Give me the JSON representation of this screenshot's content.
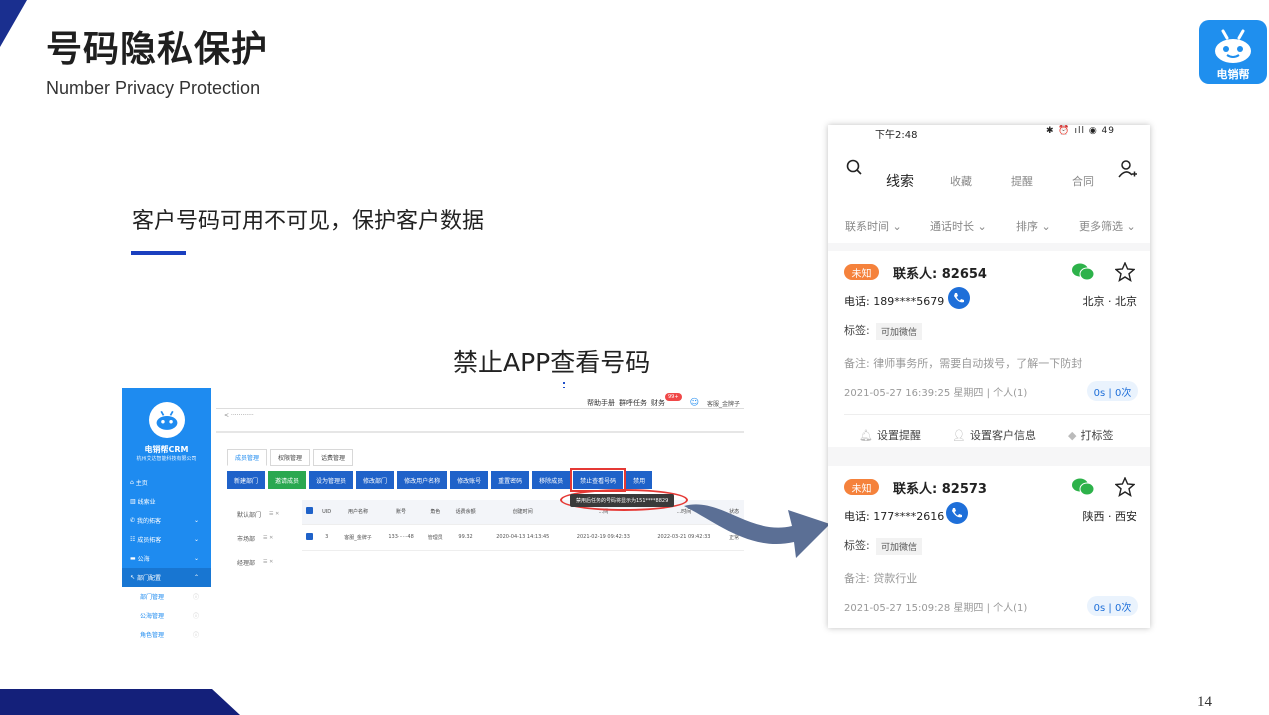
{
  "slide": {
    "title": "号码隐私保护",
    "subtitle": "Number Privacy Protection",
    "tagline": "客户号码可用不可见，保护客户数据",
    "disable_caption": "禁止APP查看号码",
    "page_number": "14",
    "accent_color": "#1a2f8f"
  },
  "logo": {
    "label": "电销帮",
    "icon": "robot-icon",
    "color": "#1f8fee"
  },
  "crm": {
    "brand": "电销帮CRM",
    "company": "杭州艾达智能科技有限公司",
    "nav": [
      {
        "label": "主页",
        "icon": "home-icon",
        "chevron": ""
      },
      {
        "label": "线索业",
        "icon": "chart-icon",
        "chevron": ""
      },
      {
        "label": "我的拓客",
        "icon": "phone-icon",
        "chevron": "⌄"
      },
      {
        "label": "成员拓客",
        "icon": "team-icon",
        "chevron": "⌄"
      },
      {
        "label": "公海",
        "icon": "folder-icon",
        "chevron": "⌄"
      },
      {
        "label": "部门配置",
        "icon": "tool-icon",
        "chevron": "⌃"
      }
    ],
    "subnav": [
      "部门管理",
      "公海管理",
      "角色管理"
    ],
    "back_label": "< ············",
    "top_links": [
      "帮助手册",
      "群呼任务",
      "财务"
    ],
    "badge": "99+",
    "user": "客服_金牌子",
    "tabs": [
      "成员管理",
      "权限管理",
      "话费管理"
    ],
    "buttons": [
      {
        "label": "新建部门",
        "style": "primary"
      },
      {
        "label": "邀请成员",
        "style": "green"
      },
      {
        "label": "设为管理员",
        "style": "primary"
      },
      {
        "label": "修改部门",
        "style": "primary"
      },
      {
        "label": "修改用户名称",
        "style": "primary"
      },
      {
        "label": "修改账号",
        "style": "primary"
      },
      {
        "label": "重置密码",
        "style": "primary"
      },
      {
        "label": "移除成员",
        "style": "primary"
      },
      {
        "label": "禁止查看号码",
        "style": "highlight"
      },
      {
        "label": "禁用",
        "style": "primary"
      }
    ],
    "tooltip": "禁用后任务的号码将显示为151****8829",
    "groups": [
      {
        "label": "默认部门",
        "ops": "☰ ✕"
      },
      {
        "label": "市场部",
        "ops": "☰ ✕"
      },
      {
        "label": "经理部",
        "ops": "☰ ✕"
      }
    ],
    "table": {
      "headers": [
        "",
        "UID",
        "用户名称",
        "账号",
        "角色",
        "话费余额",
        "创建时间",
        "...间",
        "...时间",
        "状态"
      ],
      "rows": [
        [
          "",
          "3",
          "客服_金牌子",
          "133······48",
          "管理员",
          "99.32",
          "2020-04-13 14:13:45",
          "2021-02-19 09:42:33",
          "2022-03-21 09:42:33",
          "正常"
        ]
      ]
    }
  },
  "phone": {
    "status_time": "下午2:48",
    "status_icons": "✱ ⏰ ıll ◉ 49",
    "tabs": [
      {
        "label": "线索",
        "active": true
      },
      {
        "label": "收藏",
        "active": false
      },
      {
        "label": "提醒",
        "active": false
      },
      {
        "label": "合同",
        "active": false
      }
    ],
    "filters": [
      "联系时间 ⌄",
      "通话时长 ⌄",
      "排序 ⌄",
      "更多筛选 ⌄"
    ],
    "cards": [
      {
        "status": "未知",
        "contact": "联系人: 82654",
        "phone": "电话: 189****5679",
        "region": "北京 · 北京",
        "tag_label": "标签:",
        "tag": "可加微信",
        "remark": "备注: 律师事务所，需要自动拨号，了解一下防封",
        "meta": "2021-05-27 16:39:25 星期四 | 个人(1)",
        "count": "0s | 0次",
        "actions": [
          {
            "label": "设置提醒",
            "icon": "bell-icon"
          },
          {
            "label": "设置客户信息",
            "icon": "person-icon"
          },
          {
            "label": "打标签",
            "icon": "tag-icon"
          }
        ]
      },
      {
        "status": "未知",
        "contact": "联系人: 82573",
        "phone": "电话: 177****2616",
        "region": "陕西 · 西安",
        "tag_label": "标签:",
        "tag": "可加微信",
        "remark": "备注: 贷款行业",
        "meta": "2021-05-27 15:09:28 星期四 | 个人(1)",
        "count": "0s | 0次"
      }
    ]
  }
}
